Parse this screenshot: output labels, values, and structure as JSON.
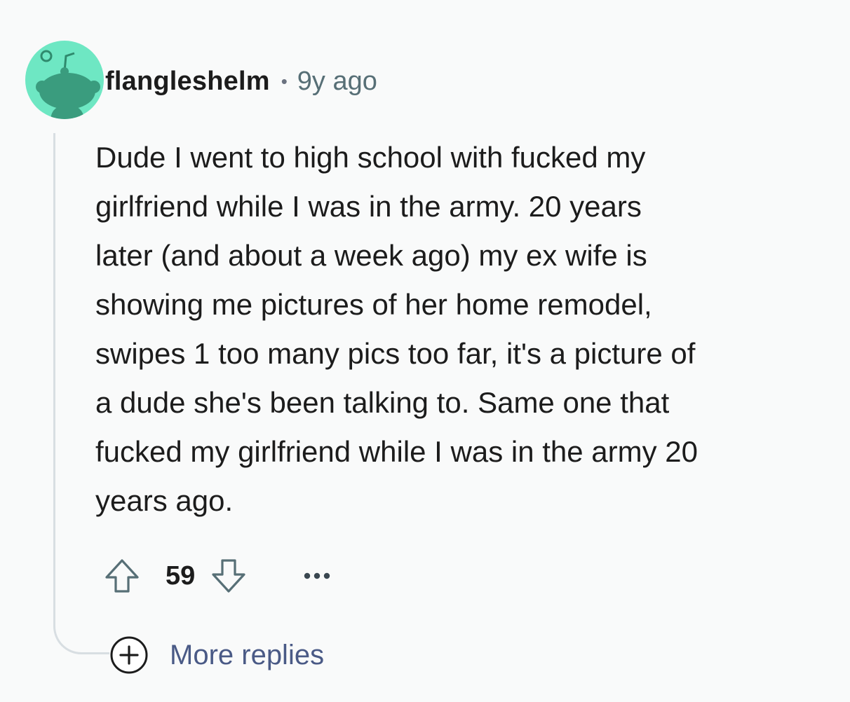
{
  "comment": {
    "author": "flangleshelm",
    "separator": "•",
    "age": "9y ago",
    "body_lines": [
      "Dude I went to high school with fucked my",
      "girlfriend while I was in the army. 20 years",
      "later (and about a week ago) my ex wife is",
      "showing me pictures of her home remodel,",
      "swipes 1 too many pics too far, it's a picture of",
      "a dude she's been talking to. Same one that",
      "fucked my girlfriend while I was in the army 20",
      "years ago."
    ],
    "score": "59",
    "more_replies_label": "More replies"
  },
  "icons": {
    "avatar": "snoo-avatar-icon",
    "upvote": "upvote-arrow-icon",
    "downvote": "downvote-arrow-icon",
    "overflow": "ellipsis-icon",
    "expand": "plus-circle-icon"
  },
  "colors": {
    "background": "#f9fafa",
    "avatar_bg": "#6ee7c3",
    "avatar_figure": "#3a9c7e",
    "text": "#1c1c1c",
    "muted": "#576f76",
    "link": "#4a5a86",
    "thread_line": "#d8dee2"
  }
}
